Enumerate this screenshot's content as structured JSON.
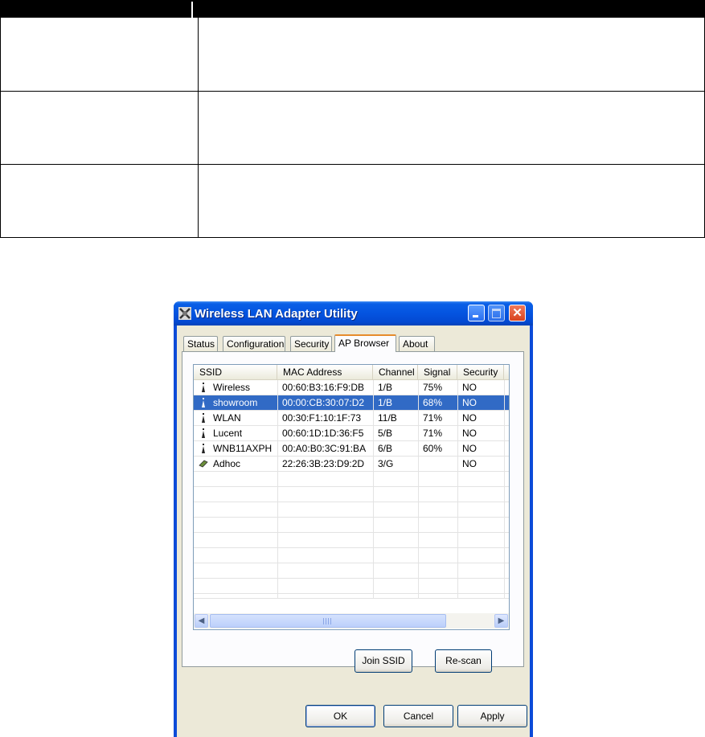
{
  "window": {
    "title": "Wireless LAN Adapter Utility"
  },
  "tabs": [
    {
      "label": "Status"
    },
    {
      "label": "Configuration"
    },
    {
      "label": "Security"
    },
    {
      "label": "AP Browser",
      "active": true
    },
    {
      "label": "About"
    }
  ],
  "list": {
    "columns": [
      "SSID",
      "MAC Address",
      "Channel",
      "Signal",
      "Security"
    ],
    "rows": [
      {
        "icon": "access-point-icon",
        "ssid": "Wireless",
        "mac": "00:60:B3:16:F9:DB",
        "channel": "1/B",
        "signal": "75%",
        "security": "NO"
      },
      {
        "icon": "access-point-icon",
        "ssid": "showroom",
        "mac": "00:00:CB:30:07:D2",
        "channel": "1/B",
        "signal": "68%",
        "security": "NO",
        "selected": true
      },
      {
        "icon": "access-point-icon",
        "ssid": "WLAN",
        "mac": "00:30:F1:10:1F:73",
        "channel": "11/B",
        "signal": "71%",
        "security": "NO"
      },
      {
        "icon": "access-point-icon",
        "ssid": "Lucent",
        "mac": "00:60:1D:1D:36:F5",
        "channel": "5/B",
        "signal": "71%",
        "security": "NO"
      },
      {
        "icon": "access-point-icon",
        "ssid": "WNB11AXPH",
        "mac": "00:A0:B0:3C:91:BA",
        "channel": "6/B",
        "signal": "60%",
        "security": "NO"
      },
      {
        "icon": "adhoc-icon",
        "ssid": "Adhoc",
        "mac": "22:26:3B:23:D9:2D",
        "channel": "3/G",
        "signal": "",
        "security": "NO"
      }
    ]
  },
  "buttons": {
    "join_ssid": "Join SSID",
    "rescan": "Re-scan",
    "ok": "OK",
    "cancel": "Cancel",
    "apply": "Apply"
  },
  "colors": {
    "selection": "#316ac5",
    "titlebar": "#0454e0",
    "active_tab_accent": "#e68b2c"
  }
}
